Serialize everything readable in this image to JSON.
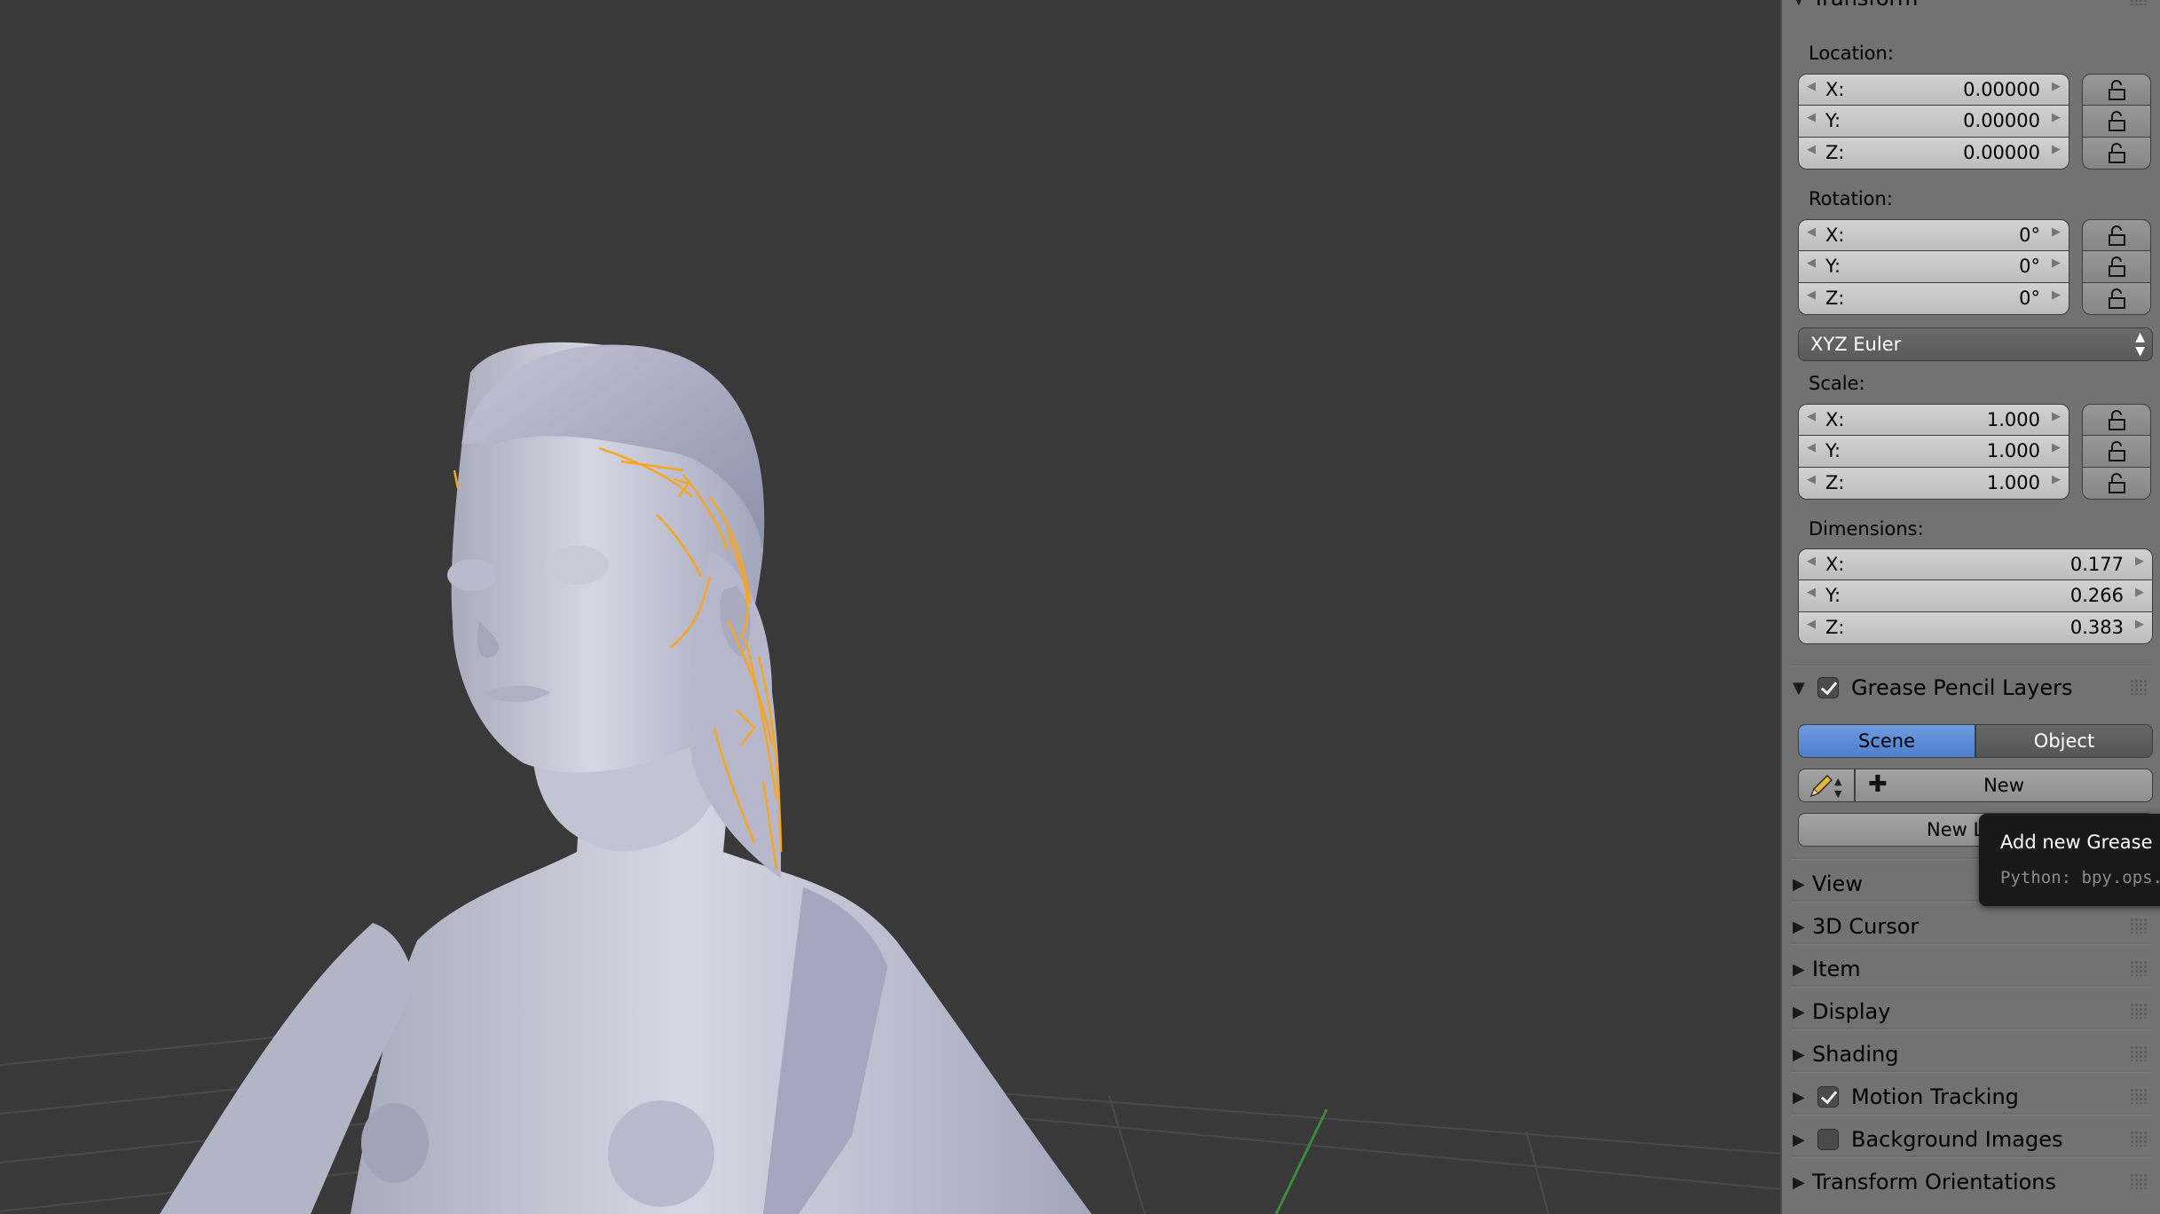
{
  "transform": {
    "header": "Transform",
    "location": {
      "label": "Location:",
      "x_label": "X:",
      "x": "0.00000",
      "y_label": "Y:",
      "y": "0.00000",
      "z_label": "Z:",
      "z": "0.00000"
    },
    "rotation": {
      "label": "Rotation:",
      "x_label": "X:",
      "x": "0°",
      "y_label": "Y:",
      "y": "0°",
      "z_label": "Z:",
      "z": "0°"
    },
    "rotation_mode": "XYZ Euler",
    "scale": {
      "label": "Scale:",
      "x_label": "X:",
      "x": "1.000",
      "y_label": "Y:",
      "y": "1.000",
      "z_label": "Z:",
      "z": "1.000"
    },
    "dimensions": {
      "label": "Dimensions:",
      "x_label": "X:",
      "x": "0.177",
      "y_label": "Y:",
      "y": "0.266",
      "z_label": "Z:",
      "z": "0.383"
    }
  },
  "grease_pencil": {
    "header": "Grease Pencil Layers",
    "enabled": true,
    "source_scene": "Scene",
    "source_object": "Object",
    "new_label": "New",
    "new_layer_label": "New Layer",
    "tooltip_title": "Add new Grease Pencil Layer",
    "tooltip_python": "Python: bpy.ops.gpencil.layer_add()"
  },
  "panels": {
    "view": "View",
    "cursor": "3D Cursor",
    "item": "Item",
    "display": "Display",
    "shading": "Shading",
    "motion_tracking": "Motion Tracking",
    "background_images": "Background Images",
    "transform_orientations": "Transform Orientations"
  },
  "colors": {
    "viewport_bg": "#393939",
    "panel_bg": "#727272",
    "selected_segment": "#5a8ad8",
    "grease_pencil_stroke": "#f5a623",
    "model": "#c8c9d8"
  }
}
